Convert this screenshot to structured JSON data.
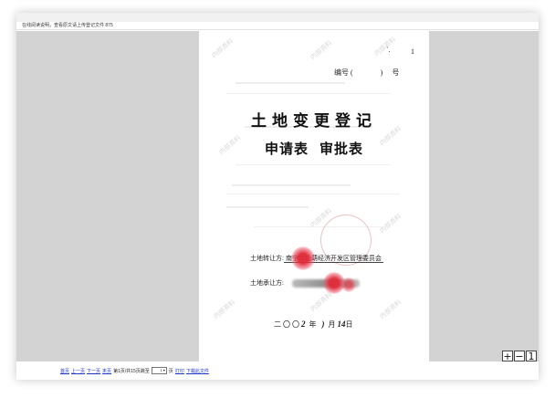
{
  "infobar": {
    "text": "在线阅读说明，查看原文请上传登记文件 875"
  },
  "document": {
    "corner_mark": "`.",
    "corner_page": "1",
    "number_label": "编号 (",
    "number_close": ")",
    "number_suffix": "号",
    "title_line1": "土地变更登记",
    "title_line2_a": "申请表",
    "title_line2_b": "审批表",
    "transferor_label": "土地转让方:",
    "transferor_value": "南宁市仙葫经济开发区管理委员会",
    "transferee_label": "土地承让方:",
    "date_prefix": "二〇〇",
    "date_year": "2",
    "date_year_label": "年",
    "date_month": ")",
    "date_month_label": "月",
    "date_day": "14",
    "date_day_label": "日",
    "watermark": "内部资料"
  },
  "pager": {
    "first": "首页",
    "prev": "上一页",
    "next": "下一页",
    "last": "末页",
    "status": "第1页/共15页跳至",
    "select_value": "1",
    "page_unit": "页",
    "print": "打印",
    "download": "下载此文件"
  },
  "zoom": {
    "in": "+",
    "out": "−",
    "third": "1"
  },
  "colors": {
    "link": "#1a35c8",
    "stamp": "#e12837",
    "viewer_bg": "#d3d3d3"
  }
}
